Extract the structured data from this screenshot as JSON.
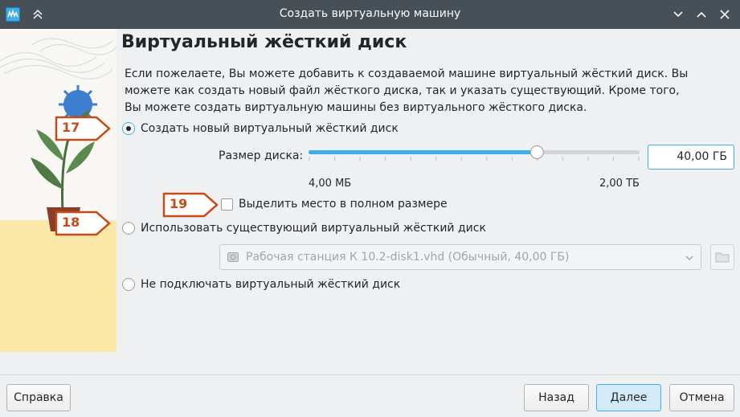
{
  "window": {
    "title": "Создать виртуальную машину"
  },
  "page": {
    "heading": "Виртуальный жёсткий диск",
    "description": "Если пожелаете, Вы можете добавить к создаваемой машине виртуальный жёсткий диск. Вы можете как создать новый файл жёсткого диска, так и указать существующий. Кроме того, Вы можете создать виртуальную машины без виртуального жёсткого диска."
  },
  "options": {
    "create_new": {
      "label": "Создать новый виртуальный жёсткий диск",
      "checked": true
    },
    "use_existing": {
      "label": "Использовать существующий виртуальный жёсткий диск",
      "checked": false
    },
    "no_disk": {
      "label": "Не подключать виртуальный жёсткий диск",
      "checked": false
    }
  },
  "disk_size": {
    "label": "Размер диска:",
    "value": "40,00 ГБ",
    "min_label": "4,00 МБ",
    "max_label": "2,00 ТБ",
    "slider_fraction": 0.69
  },
  "preallocate": {
    "label": "Выделить место в полном размере",
    "checked": false
  },
  "existing_disk": {
    "selected": "Рабочая станция К 10.2-disk1.vhd (Обычный, 40,00 ГБ)"
  },
  "badges": [
    "17",
    "18",
    "19"
  ],
  "buttons": {
    "help": "Справка",
    "back": "Назад",
    "next": "Далее",
    "cancel": "Отмена"
  },
  "colors": {
    "titlebar": "#475057",
    "accent": "#3daee9",
    "badge_outline": "#c74b16"
  },
  "icons": {
    "app": "virtualbox-icon",
    "keep_above": "chevron-up-double-icon",
    "minimize": "chevron-down-icon",
    "maximize": "chevron-up-icon",
    "close": "close-icon",
    "disk": "hard-disk-icon",
    "folder": "folder-icon",
    "combo": "chevron-down-icon"
  }
}
